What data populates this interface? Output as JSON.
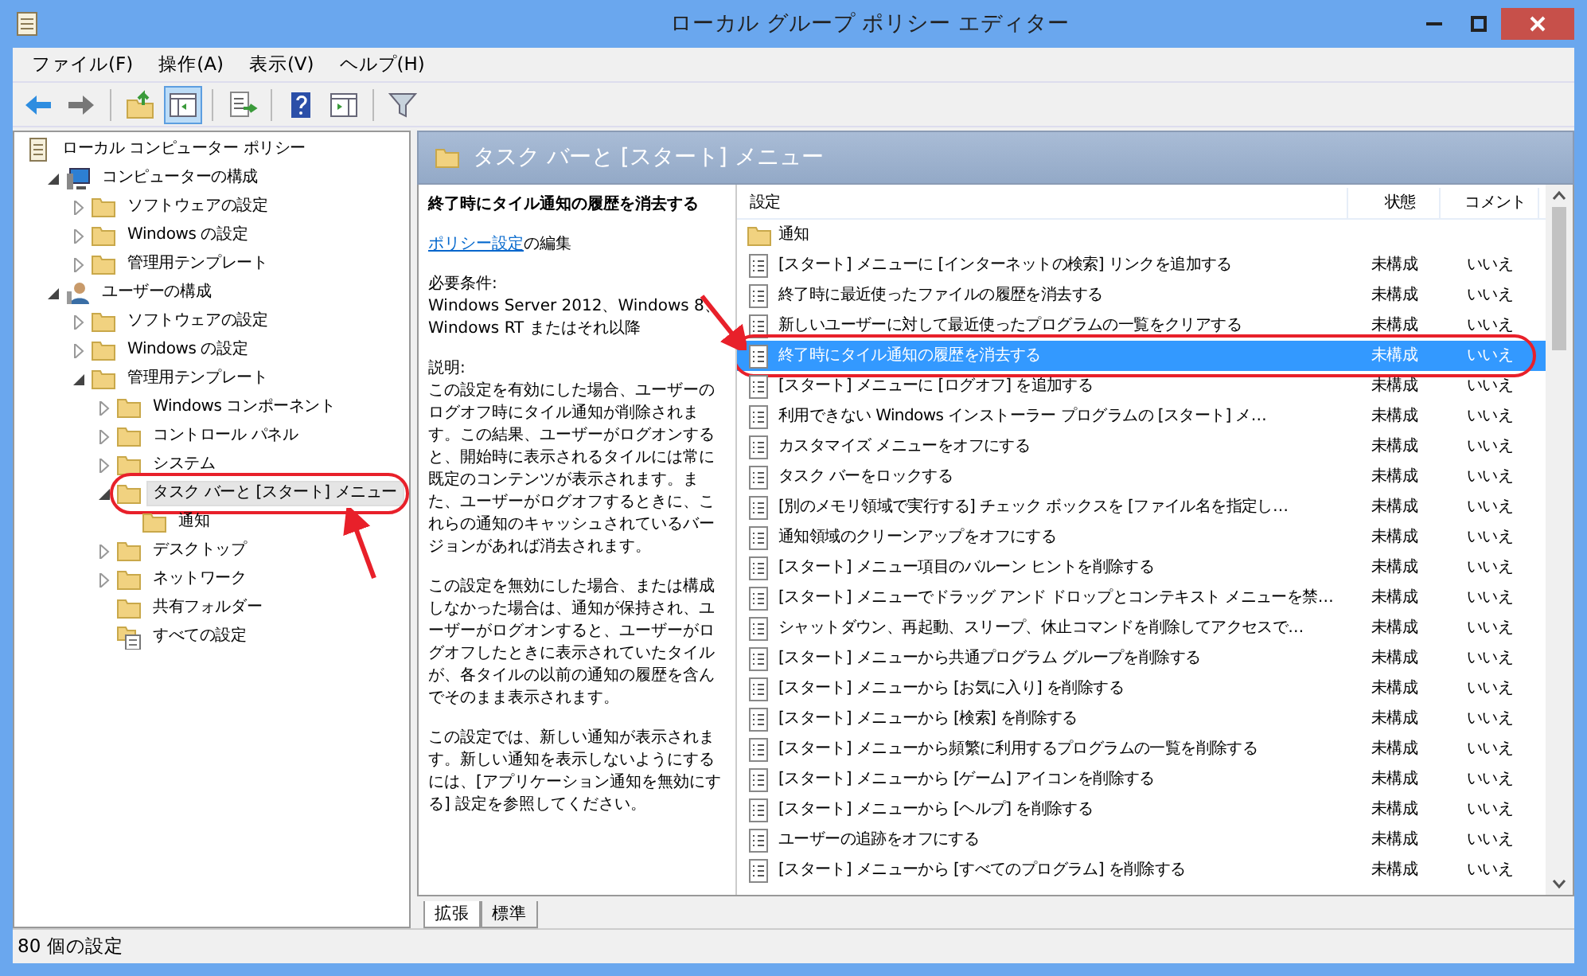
{
  "window": {
    "title": "ローカル グループ ポリシー エディター"
  },
  "menu": [
    "ファイル(F)",
    "操作(A)",
    "表示(V)",
    "ヘルプ(H)"
  ],
  "toolbar": [
    {
      "kind": "back",
      "selected": false
    },
    {
      "kind": "forward",
      "selected": false
    },
    {
      "kind": "sep"
    },
    {
      "kind": "up",
      "selected": false
    },
    {
      "kind": "tree",
      "selected": true
    },
    {
      "kind": "sep"
    },
    {
      "kind": "export",
      "selected": false
    },
    {
      "kind": "sep"
    },
    {
      "kind": "help",
      "selected": false
    },
    {
      "kind": "props",
      "selected": false
    },
    {
      "kind": "sep"
    },
    {
      "kind": "filter",
      "selected": false
    }
  ],
  "tree": [
    {
      "label": "ローカル コンピューター ポリシー",
      "kind": "policy",
      "selected": false,
      "children": [
        {
          "label": "コンピューターの構成",
          "kind": "computer",
          "expanded": true,
          "selected": false,
          "children": [
            {
              "label": "ソフトウェアの設定",
              "kind": "folder",
              "expanded": false,
              "selected": false
            },
            {
              "label": "Windows の設定",
              "kind": "folder",
              "expanded": false,
              "selected": false
            },
            {
              "label": "管理用テンプレート",
              "kind": "folder",
              "expanded": false,
              "selected": false
            }
          ]
        },
        {
          "label": "ユーザーの構成",
          "kind": "user",
          "expanded": true,
          "selected": false,
          "children": [
            {
              "label": "ソフトウェアの設定",
              "kind": "folder",
              "expanded": false,
              "selected": false
            },
            {
              "label": "Windows の設定",
              "kind": "folder",
              "expanded": false,
              "selected": false
            },
            {
              "label": "管理用テンプレート",
              "kind": "folder",
              "expanded": true,
              "selected": false,
              "children": [
                {
                  "label": "Windows コンポーネント",
                  "kind": "folder",
                  "expanded": false,
                  "selected": false
                },
                {
                  "label": "コントロール パネル",
                  "kind": "folder",
                  "expanded": false,
                  "selected": false
                },
                {
                  "label": "システム",
                  "kind": "folder",
                  "expanded": false,
                  "selected": false
                },
                {
                  "label": "タスク バーと [スタート] メニュー",
                  "kind": "folder",
                  "expanded": true,
                  "selected": true,
                  "children": [
                    {
                      "label": "通知",
                      "kind": "folder",
                      "selected": false
                    }
                  ]
                },
                {
                  "label": "デスクトップ",
                  "kind": "folder",
                  "expanded": false,
                  "selected": false
                },
                {
                  "label": "ネットワーク",
                  "kind": "folder",
                  "expanded": false,
                  "selected": false
                },
                {
                  "label": "共有フォルダー",
                  "kind": "folder",
                  "selected": false
                },
                {
                  "label": "すべての設定",
                  "kind": "allsettings",
                  "selected": false
                }
              ]
            }
          ]
        }
      ]
    }
  ],
  "header": {
    "title": "タスク バーと [スタート] メニュー"
  },
  "description": {
    "title": "終了時にタイル通知の履歴を消去する",
    "link": "ポリシー設定",
    "link_suffix": "の編集",
    "requirements_label": "必要条件:",
    "requirements": "Windows Server 2012、Windows 8、Windows RT またはそれ以降",
    "description_label": "説明:",
    "paragraphs": [
      "この設定を有効にした場合、ユーザーのログオフ時にタイル通知が削除されます。この結果、ユーザーがログオンすると、開始時に表示されるタイルには常に既定のコンテンツが表示されます。また、ユーザーがログオフするときに、これらの通知のキャッシュされているバージョンがあれば消去されます。",
      "この設定を無効にした場合、または構成しなかった場合は、通知が保持され、ユーザーがログオンすると、ユーザーがログオフしたときに表示されていたタイルが、各タイルの以前の通知の履歴を含んでそのまま表示されます。",
      "この設定では、新しい通知が表示されます。新しい通知を表示しないようにするには、[アプリケーション通知を無効にする] 設定を参照してください。"
    ]
  },
  "table": {
    "columns": [
      "設定",
      "状態",
      "コメント"
    ],
    "rows": [
      {
        "kind": "folder",
        "name": "通知",
        "selected": false
      },
      {
        "kind": "policy",
        "name": "[スタート] メニューに [インターネットの検索] リンクを追加する",
        "state": "未構成",
        "comment": "いいえ",
        "selected": false
      },
      {
        "kind": "policy",
        "name": "終了時に最近使ったファイルの履歴を消去する",
        "state": "未構成",
        "comment": "いいえ",
        "selected": false
      },
      {
        "kind": "policy",
        "name": "新しいユーザーに対して最近使ったプログラムの一覧をクリアする",
        "state": "未構成",
        "comment": "いいえ",
        "selected": false
      },
      {
        "kind": "policy",
        "name": "終了時にタイル通知の履歴を消去する",
        "state": "未構成",
        "comment": "いいえ",
        "selected": true
      },
      {
        "kind": "policy",
        "name": "[スタート] メニューに [ログオフ] を追加する",
        "state": "未構成",
        "comment": "いいえ",
        "selected": false
      },
      {
        "kind": "policy",
        "name": "利用できない Windows インストーラー プログラムの [スタート] メ…",
        "state": "未構成",
        "comment": "いいえ",
        "selected": false
      },
      {
        "kind": "policy",
        "name": "カスタマイズ メニューをオフにする",
        "state": "未構成",
        "comment": "いいえ",
        "selected": false
      },
      {
        "kind": "policy",
        "name": "タスク バーをロックする",
        "state": "未構成",
        "comment": "いいえ",
        "selected": false
      },
      {
        "kind": "policy",
        "name": "[別のメモリ領域で実行する] チェック ボックスを [ファイル名を指定し…",
        "state": "未構成",
        "comment": "いいえ",
        "selected": false
      },
      {
        "kind": "policy",
        "name": "通知領域のクリーンアップをオフにする",
        "state": "未構成",
        "comment": "いいえ",
        "selected": false
      },
      {
        "kind": "policy",
        "name": "[スタート] メニュー項目のバルーン ヒントを削除する",
        "state": "未構成",
        "comment": "いいえ",
        "selected": false
      },
      {
        "kind": "policy",
        "name": "[スタート] メニューでドラッグ アンド ドロップとコンテキスト メニューを禁…",
        "state": "未構成",
        "comment": "いいえ",
        "selected": false
      },
      {
        "kind": "policy",
        "name": "シャットダウン、再起動、スリープ、休止コマンドを削除してアクセスで…",
        "state": "未構成",
        "comment": "いいえ",
        "selected": false
      },
      {
        "kind": "policy",
        "name": "[スタート] メニューから共通プログラム グループを削除する",
        "state": "未構成",
        "comment": "いいえ",
        "selected": false
      },
      {
        "kind": "policy",
        "name": "[スタート] メニューから [お気に入り] を削除する",
        "state": "未構成",
        "comment": "いいえ",
        "selected": false
      },
      {
        "kind": "policy",
        "name": "[スタート] メニューから [検索] を削除する",
        "state": "未構成",
        "comment": "いいえ",
        "selected": false
      },
      {
        "kind": "policy",
        "name": "[スタート] メニューから頻繁に利用するプログラムの一覧を削除する",
        "state": "未構成",
        "comment": "いいえ",
        "selected": false
      },
      {
        "kind": "policy",
        "name": "[スタート] メニューから [ゲーム] アイコンを削除する",
        "state": "未構成",
        "comment": "いいえ",
        "selected": false
      },
      {
        "kind": "policy",
        "name": "[スタート] メニューから [ヘルプ] を削除する",
        "state": "未構成",
        "comment": "いいえ",
        "selected": false
      },
      {
        "kind": "policy",
        "name": "ユーザーの追跡をオフにする",
        "state": "未構成",
        "comment": "いいえ",
        "selected": false
      },
      {
        "kind": "policy",
        "name": "[スタート] メニューから [すべてのプログラム] を削除する",
        "state": "未構成",
        "comment": "いいえ",
        "selected": false
      }
    ]
  },
  "view_tabs": [
    {
      "label": "拡張",
      "selected": true
    },
    {
      "label": "標準",
      "selected": false
    }
  ],
  "status_bar": {
    "text": "80 個の設定"
  }
}
